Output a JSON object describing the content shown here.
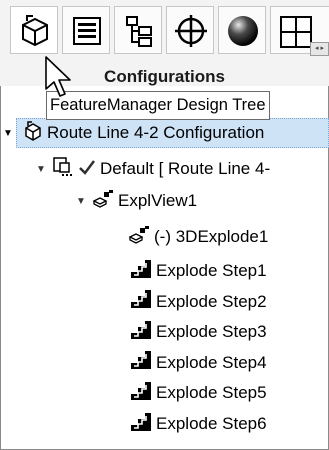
{
  "tooltip": {
    "text": "FeatureManager Design Tree"
  },
  "panel": {
    "title": "Configurations"
  },
  "tabs": [
    {
      "icon": "featuremanager-tree-icon"
    },
    {
      "icon": "property-manager-icon"
    },
    {
      "icon": "configuration-manager-icon"
    },
    {
      "icon": "dimxpert-manager-icon"
    },
    {
      "icon": "display-manager-icon"
    }
  ],
  "tree": {
    "root_label": "Route Line 4-2 Configuration",
    "default_label": "Default [ Route Line 4-",
    "explview_label": "ExplView1",
    "explode3d_label": "(-) 3DExplode1",
    "steps": [
      "Explode Step1",
      "Explode Step2",
      "Explode Step3",
      "Explode Step4",
      "Explode Step5",
      "Explode Step6"
    ]
  },
  "colors": {
    "selection": "#cfe3f7",
    "check": "#2f2f2f"
  }
}
